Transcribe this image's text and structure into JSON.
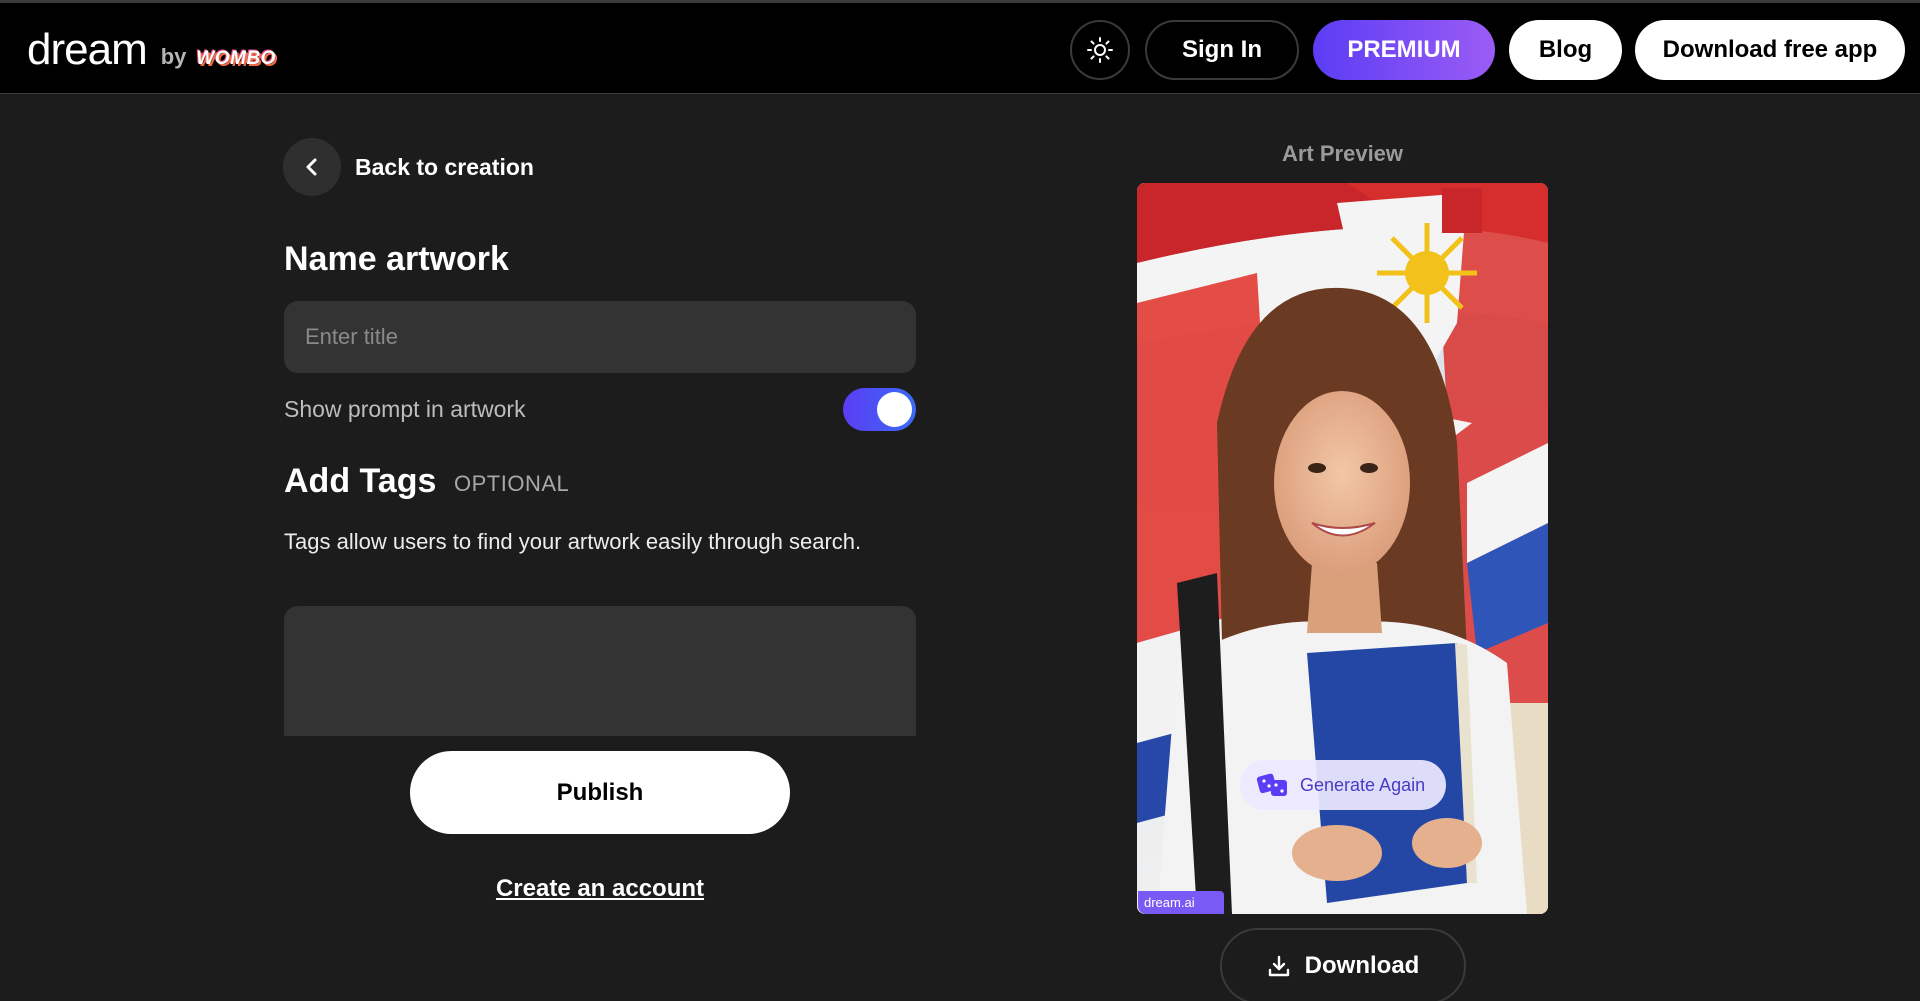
{
  "header": {
    "logo_main": "dream",
    "logo_by": "by",
    "logo_brand": "WOMBO",
    "theme_icon": "sun-icon",
    "signin_label": "Sign In",
    "premium_label": "PREMIUM",
    "blog_label": "Blog",
    "download_app_label": "Download free app"
  },
  "form": {
    "back_label": "Back to creation",
    "name_title": "Name artwork",
    "title_placeholder": "Enter title",
    "title_value": "",
    "show_prompt_label": "Show prompt in artwork",
    "show_prompt_enabled": true,
    "tags_title": "Add Tags",
    "tags_optional": "OPTIONAL",
    "tags_description": "Tags allow users to find your artwork easily through search.",
    "tags_value": "",
    "publish_label": "Publish",
    "create_account_label": "Create an account"
  },
  "preview": {
    "label": "Art Preview",
    "generate_again_label": "Generate Again",
    "watermark": "dream.ai",
    "download_label": "Download"
  },
  "colors": {
    "background": "#1c1c1c",
    "accent": "#5b3df5"
  }
}
